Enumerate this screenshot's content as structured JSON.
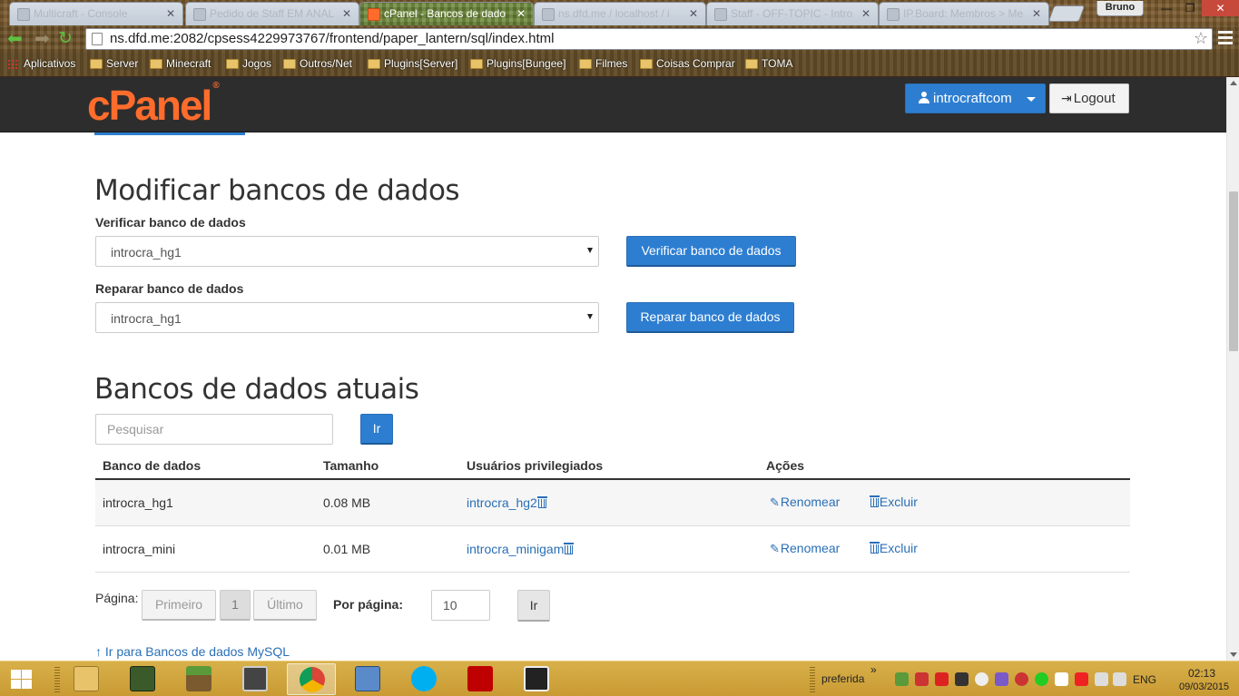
{
  "browser": {
    "tabs": [
      {
        "label": "Multicraft - Console",
        "active": false
      },
      {
        "label": "Pedido de Staff EM ANAL",
        "active": false
      },
      {
        "label": "cPanel - Bancos de dado",
        "active": true
      },
      {
        "label": "ns.dfd.me / localhost / i",
        "active": false
      },
      {
        "label": "Staff - OFF-TOPIC - Intro",
        "active": false
      },
      {
        "label": "IP.Board: Membros > Me",
        "active": false
      }
    ],
    "profile": "Bruno",
    "url": "ns.dfd.me:2082/cpsess4229973767/frontend/paper_lantern/sql/index.html",
    "bookmarks": [
      "Aplicativos",
      "Server",
      "Minecraft",
      "Jogos",
      "Outros/Net",
      "Plugins[Server]",
      "Plugins[Bungee]",
      "Filmes",
      "Coisas Comprar",
      "TOMA"
    ]
  },
  "header": {
    "logo": "cPanel",
    "user": "introcraftcom",
    "logout": "Logout",
    "brand_color": "#ff6c2c",
    "accent_color": "#2d7ed1"
  },
  "modify": {
    "title": "Modificar bancos de dados",
    "check_label": "Verificar banco de dados",
    "check_value": "introcra_hg1",
    "check_button": "Verificar banco de dados",
    "repair_label": "Reparar banco de dados",
    "repair_value": "introcra_hg1",
    "repair_button": "Reparar banco de dados"
  },
  "current": {
    "title": "Bancos de dados atuais",
    "search_placeholder": "Pesquisar",
    "search_button": "Ir",
    "columns": [
      "Banco de dados",
      "Tamanho",
      "Usuários privilegiados",
      "Ações"
    ],
    "rows": [
      {
        "db": "introcra_hg1",
        "size": "0.08 MB",
        "user": "introcra_hg2",
        "rename": "Renomear",
        "delete": "Excluir"
      },
      {
        "db": "introcra_mini",
        "size": "0.01 MB",
        "user": "introcra_minigam",
        "rename": "Renomear",
        "delete": "Excluir"
      }
    ]
  },
  "pagination": {
    "label": "Página:",
    "first": "Primeiro",
    "current": "1",
    "last": "Último",
    "per_page_label": "Por página:",
    "per_page_value": "10",
    "go": "Ir"
  },
  "back_link": "Ir para Bancos de dados MySQL",
  "taskbar": {
    "tray_label": "preferida",
    "language": "ENG",
    "time": "02:13",
    "date": "09/03/2015"
  }
}
